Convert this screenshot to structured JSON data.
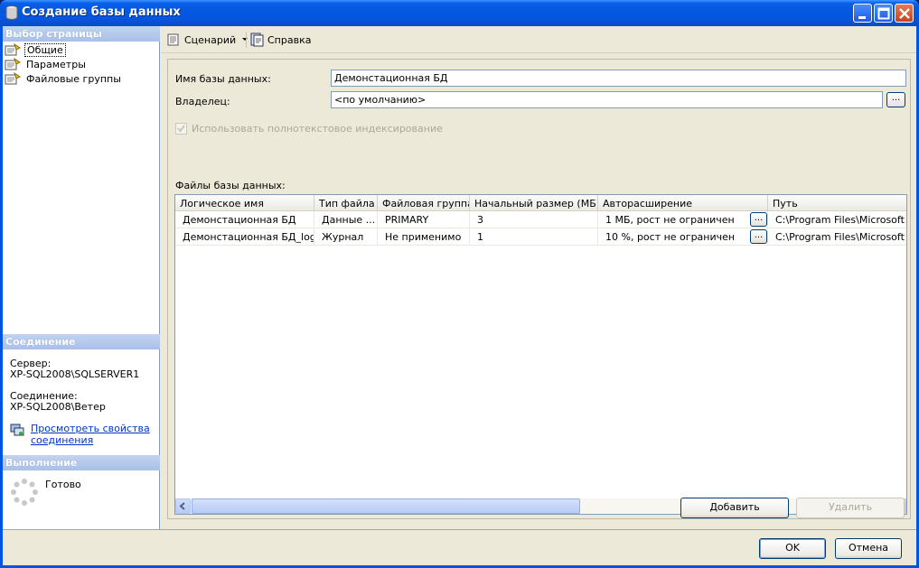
{
  "window": {
    "title": "Создание базы данных"
  },
  "sidebar": {
    "pages_header": "Выбор страницы",
    "pages": [
      {
        "label": "Общие",
        "selected": true
      },
      {
        "label": "Параметры",
        "selected": false
      },
      {
        "label": "Файловые группы",
        "selected": false
      }
    ],
    "connection_header": "Соединение",
    "server_label": "Сервер:",
    "server_value": "XP-SQL2008\\SQLSERVER1",
    "connection_label": "Соединение:",
    "connection_value": "XP-SQL2008\\Ветер",
    "view_link_line1": "Просмотреть свойства",
    "view_link_line2": "соединения",
    "progress_header": "Выполнение",
    "progress_status": "Готово"
  },
  "toolbar": {
    "script_label": "Сценарий",
    "help_label": "Справка"
  },
  "form": {
    "db_name_label": "Имя базы данных:",
    "db_name_value": "Демонстационная БД",
    "owner_label": "Владелец:",
    "owner_value": "<по умолчанию>",
    "browse_label": "...",
    "fulltext_label": "Использовать полнотекстовое индексирование",
    "files_label": "Файлы базы данных:"
  },
  "files_table": {
    "columns": [
      "Логическое имя",
      "Тип файла",
      "Файловая группа",
      "Начальный размер (МБ)",
      "Авторасширение",
      "Путь"
    ],
    "rows": [
      [
        "Демонстационная БД",
        "Данные ...",
        "PRIMARY",
        "3",
        "1 МБ, рост не ограничен",
        "C:\\Program Files\\Microsoft SQ"
      ],
      [
        "Демонстационная БД_log",
        "Журнал",
        "Не применимо",
        "1",
        "10 %, рост не ограничен",
        "C:\\Program Files\\Microsoft SQ"
      ]
    ],
    "row_button": "..."
  },
  "buttons": {
    "add": "Добавить",
    "remove": "Удалить",
    "ok": "OK",
    "cancel": "Отмена"
  }
}
